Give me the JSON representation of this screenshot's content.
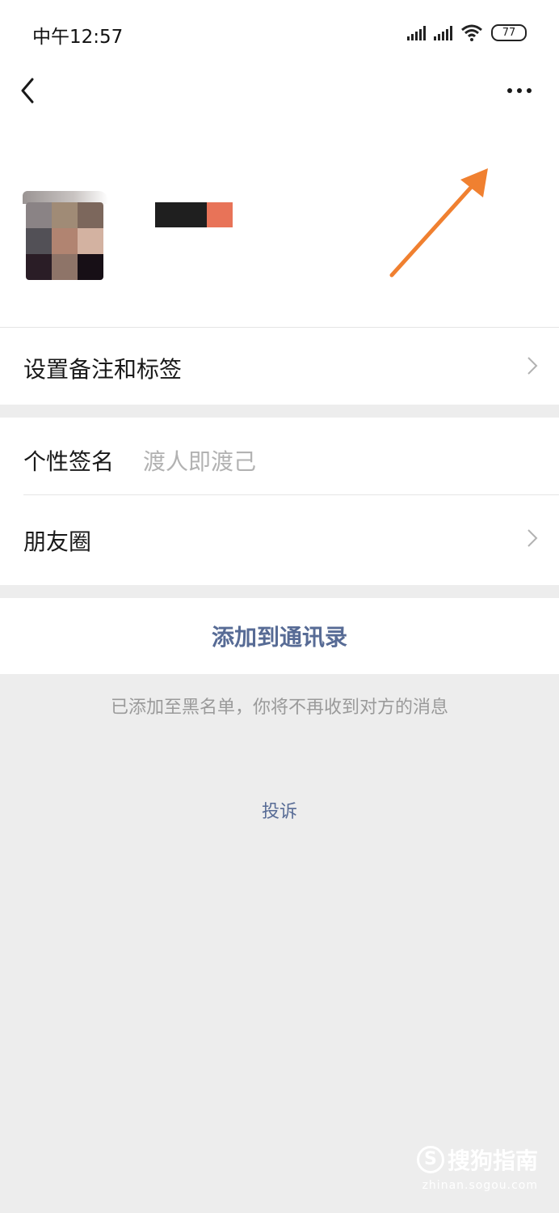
{
  "status_bar": {
    "time": "中午12:57",
    "battery": "77"
  },
  "profile": {
    "avatar_colors": [
      "#8a8385",
      "#a08b76",
      "#7c675c",
      "#525056",
      "#b18471",
      "#d3b2a1",
      "#2a1d26",
      "#8e7468",
      "#170f16"
    ],
    "name_colors": [
      "#1f1f1f",
      "#e87358"
    ]
  },
  "annotation": {
    "arrow_color": "#f08030"
  },
  "menu": {
    "remark_tags": "设置备注和标签",
    "signature_label": "个性签名",
    "signature_value": "渡人即渡己",
    "moments": "朋友圈"
  },
  "actions": {
    "add_to_contacts": "添加到通讯录",
    "blacklist_notice": "已添加至黑名单，你将不再收到对方的消息",
    "complain": "投诉"
  },
  "watermark": {
    "logo_letter": "S",
    "brand": "搜狗指南",
    "domain": "zhinan.sogou.com"
  },
  "colors": {
    "link": "#576b95",
    "background": "#ededed"
  }
}
